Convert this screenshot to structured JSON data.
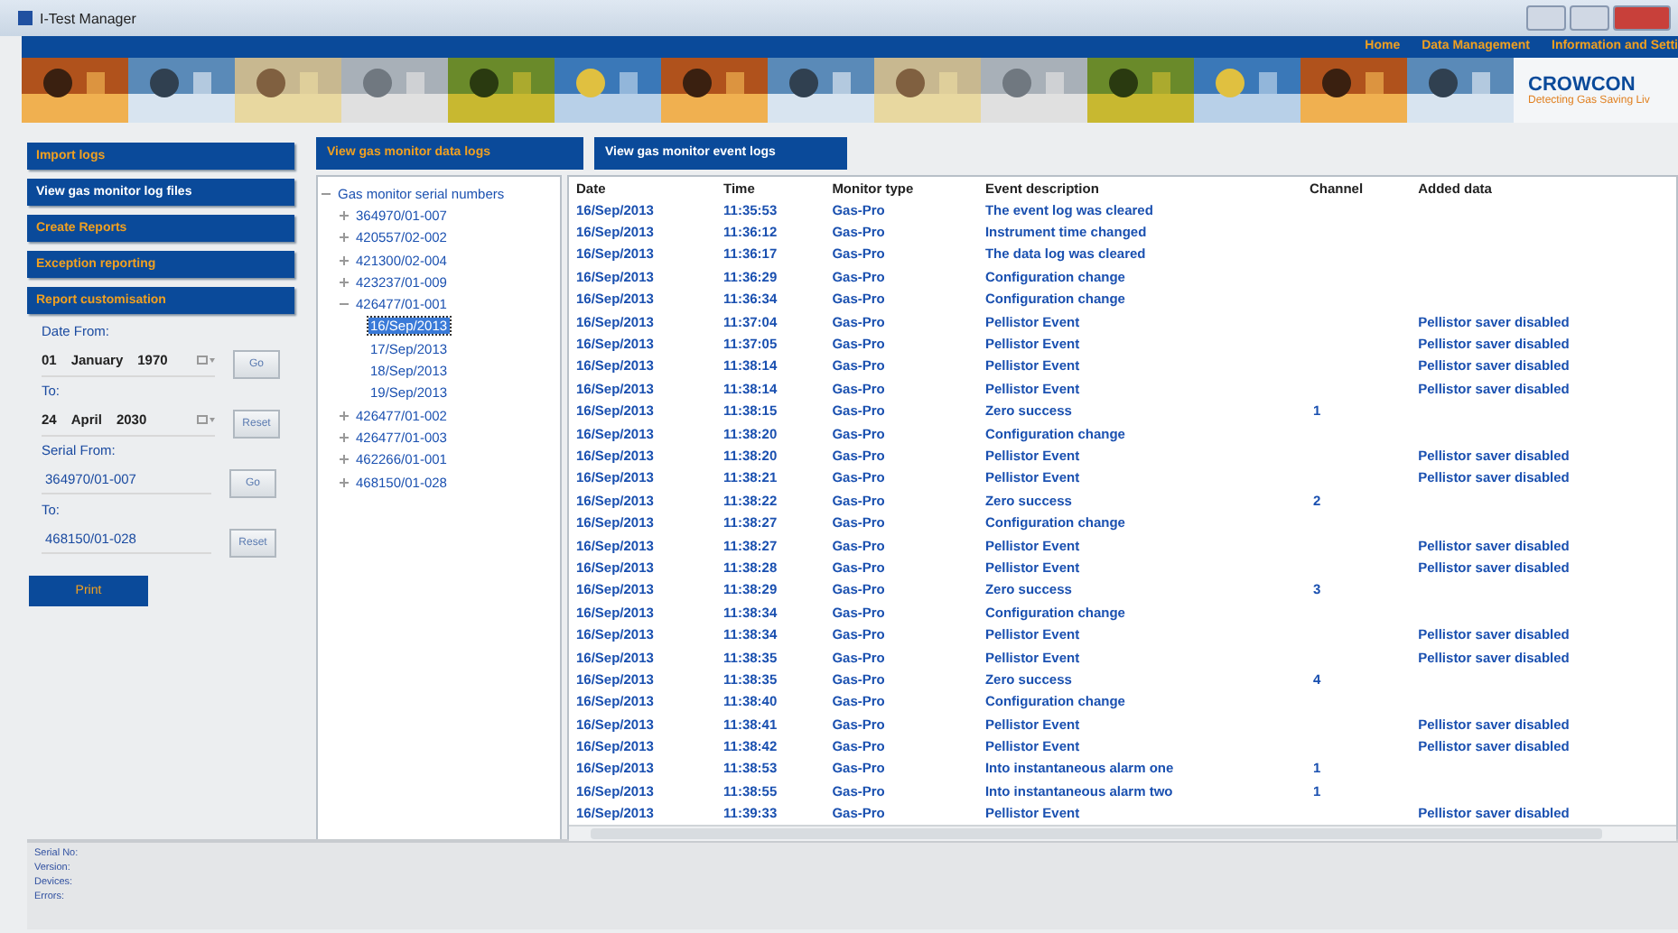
{
  "window": {
    "title": "I-Test Manager"
  },
  "nav": [
    "Home",
    "Data Management",
    "Information and Setti"
  ],
  "logo": {
    "name": "CROWCON",
    "tagline": "Detecting Gas Saving Liv"
  },
  "sidebar": {
    "items": [
      {
        "label": "Import logs",
        "selected": false
      },
      {
        "label": "View gas monitor log files",
        "selected": true
      },
      {
        "label": "Create Reports",
        "selected": false
      },
      {
        "label": "Exception reporting",
        "selected": false
      },
      {
        "label": "Report customisation",
        "selected": false
      }
    ],
    "date_from_label": "Date From:",
    "date_from": [
      "01",
      "January",
      "1970"
    ],
    "go_button": "Go",
    "date_to_label": "To:",
    "date_to": [
      "24",
      "April",
      "2030"
    ],
    "reset_button": "Reset",
    "serial_from_label": "Serial From:",
    "serial_from": "364970/01-007",
    "serial_go_button": "Go",
    "serial_to_label": "To:",
    "serial_to": "468150/01-028",
    "serial_reset_button": "Reset",
    "print_button": "Print"
  },
  "tabs": [
    {
      "label": "View gas monitor data logs",
      "selected": false
    },
    {
      "label": "View gas monitor event logs",
      "selected": true
    }
  ],
  "tree": {
    "label": "Gas monitor serial numbers",
    "expanded": true,
    "children": [
      {
        "label": "364970/01-007",
        "expanded": false,
        "selected": false
      },
      {
        "label": "420557/02-002",
        "expanded": false,
        "selected": false
      },
      {
        "label": "421300/02-004",
        "expanded": false,
        "selected": false
      },
      {
        "label": "423237/01-009",
        "expanded": false,
        "selected": false
      },
      {
        "label": "426477/01-001",
        "expanded": true,
        "selected": false,
        "children": [
          {
            "label": "16/Sep/2013",
            "selected": true
          },
          {
            "label": "17/Sep/2013",
            "selected": false
          },
          {
            "label": "18/Sep/2013",
            "selected": false
          },
          {
            "label": "19/Sep/2013",
            "selected": false
          }
        ]
      },
      {
        "label": "426477/01-002",
        "expanded": false,
        "selected": false
      },
      {
        "label": "426477/01-003",
        "expanded": false,
        "selected": false
      },
      {
        "label": "462266/01-001",
        "expanded": false,
        "selected": false
      },
      {
        "label": "468150/01-028",
        "expanded": false,
        "selected": false
      }
    ]
  },
  "table": {
    "columns": [
      "Date",
      "Time",
      "Monitor type",
      "Event description",
      "Channel",
      "Added data"
    ],
    "rows": [
      [
        "16/Sep/2013",
        "11:35:53",
        "Gas-Pro",
        "The event log was cleared",
        "",
        ""
      ],
      [
        "16/Sep/2013",
        "11:36:12",
        "Gas-Pro",
        "Instrument time changed",
        "",
        ""
      ],
      [
        "16/Sep/2013",
        "11:36:17",
        "Gas-Pro",
        "The data log was cleared",
        "",
        ""
      ],
      [
        "16/Sep/2013",
        "11:36:29",
        "Gas-Pro",
        "Configuration change",
        "",
        ""
      ],
      [
        "16/Sep/2013",
        "11:36:34",
        "Gas-Pro",
        "Configuration change",
        "",
        ""
      ],
      [
        "16/Sep/2013",
        "11:37:04",
        "Gas-Pro",
        "Pellistor Event",
        "",
        "Pellistor saver disabled"
      ],
      [
        "16/Sep/2013",
        "11:37:05",
        "Gas-Pro",
        "Pellistor Event",
        "",
        "Pellistor saver disabled"
      ],
      [
        "16/Sep/2013",
        "11:38:14",
        "Gas-Pro",
        "Pellistor Event",
        "",
        "Pellistor saver disabled"
      ],
      [
        "16/Sep/2013",
        "11:38:14",
        "Gas-Pro",
        "Pellistor Event",
        "",
        "Pellistor saver disabled"
      ],
      [
        "16/Sep/2013",
        "11:38:15",
        "Gas-Pro",
        "Zero success",
        "1",
        ""
      ],
      [
        "16/Sep/2013",
        "11:38:20",
        "Gas-Pro",
        "Configuration change",
        "",
        ""
      ],
      [
        "16/Sep/2013",
        "11:38:20",
        "Gas-Pro",
        "Pellistor Event",
        "",
        "Pellistor saver disabled"
      ],
      [
        "16/Sep/2013",
        "11:38:21",
        "Gas-Pro",
        "Pellistor Event",
        "",
        "Pellistor saver disabled"
      ],
      [
        "16/Sep/2013",
        "11:38:22",
        "Gas-Pro",
        "Zero success",
        "2",
        ""
      ],
      [
        "16/Sep/2013",
        "11:38:27",
        "Gas-Pro",
        "Configuration change",
        "",
        ""
      ],
      [
        "16/Sep/2013",
        "11:38:27",
        "Gas-Pro",
        "Pellistor Event",
        "",
        "Pellistor saver disabled"
      ],
      [
        "16/Sep/2013",
        "11:38:28",
        "Gas-Pro",
        "Pellistor Event",
        "",
        "Pellistor saver disabled"
      ],
      [
        "16/Sep/2013",
        "11:38:29",
        "Gas-Pro",
        "Zero success",
        "3",
        ""
      ],
      [
        "16/Sep/2013",
        "11:38:34",
        "Gas-Pro",
        "Configuration change",
        "",
        ""
      ],
      [
        "16/Sep/2013",
        "11:38:34",
        "Gas-Pro",
        "Pellistor Event",
        "",
        "Pellistor saver disabled"
      ],
      [
        "16/Sep/2013",
        "11:38:35",
        "Gas-Pro",
        "Pellistor Event",
        "",
        "Pellistor saver disabled"
      ],
      [
        "16/Sep/2013",
        "11:38:35",
        "Gas-Pro",
        "Zero success",
        "4",
        ""
      ],
      [
        "16/Sep/2013",
        "11:38:40",
        "Gas-Pro",
        "Configuration change",
        "",
        ""
      ],
      [
        "16/Sep/2013",
        "11:38:41",
        "Gas-Pro",
        "Pellistor Event",
        "",
        "Pellistor saver disabled"
      ],
      [
        "16/Sep/2013",
        "11:38:42",
        "Gas-Pro",
        "Pellistor Event",
        "",
        "Pellistor saver disabled"
      ],
      [
        "16/Sep/2013",
        "11:38:53",
        "Gas-Pro",
        "Into instantaneous alarm one",
        "1",
        ""
      ],
      [
        "16/Sep/2013",
        "11:38:55",
        "Gas-Pro",
        "Into instantaneous alarm two",
        "1",
        ""
      ],
      [
        "16/Sep/2013",
        "11:39:33",
        "Gas-Pro",
        "Pellistor Event",
        "",
        "Pellistor saver disabled"
      ]
    ]
  },
  "status_bar": [
    "Serial No:",
    "Version:",
    "Devices:",
    "Errors:"
  ]
}
